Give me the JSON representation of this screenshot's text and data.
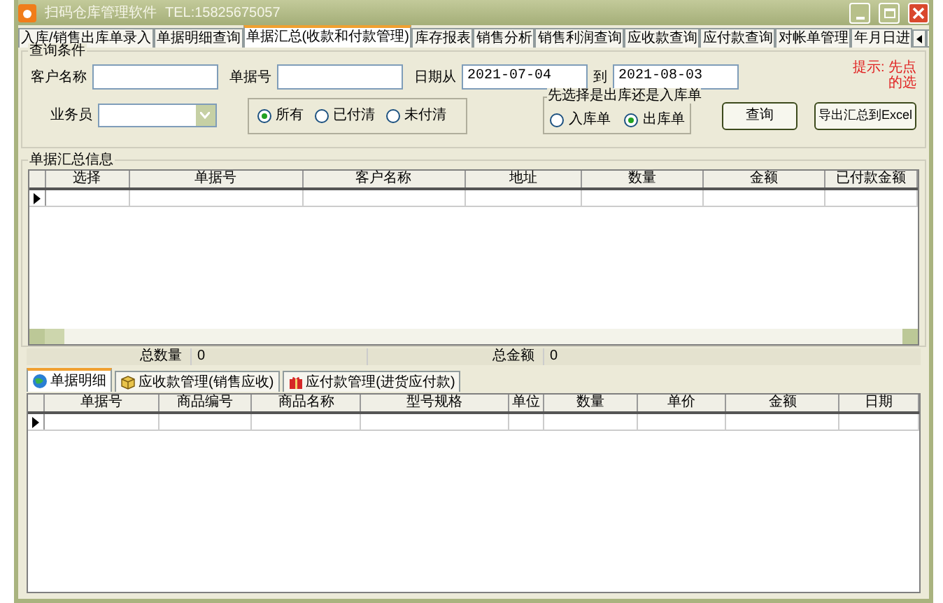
{
  "window": {
    "title": "扫码仓库管理软件",
    "phone": "TEL:15825675057"
  },
  "tabs": [
    {
      "label": "入库/销售出库单录入",
      "selected": false
    },
    {
      "label": "单据明细查询",
      "selected": false
    },
    {
      "label": "单据汇总(收款和付款管理)",
      "selected": true
    },
    {
      "label": "库存报表",
      "selected": false
    },
    {
      "label": "销售分析",
      "selected": false
    },
    {
      "label": "销售利润查询",
      "selected": false
    },
    {
      "label": "应收款查询",
      "selected": false
    },
    {
      "label": "应付款查询",
      "selected": false
    },
    {
      "label": "对帐单管理",
      "selected": false
    },
    {
      "label": "年月日进",
      "selected": false
    }
  ],
  "query": {
    "legend": "查询条件",
    "customer_label": "客户名称",
    "doc_no_label": "单据号",
    "date_from": {
      "label": "日期从",
      "value": "2021-07-04"
    },
    "date_to": {
      "label": "到",
      "value": "2021-08-03"
    },
    "salesperson_label": "业务员",
    "payment_filter": [
      {
        "label": "所有",
        "selected": true
      },
      {
        "label": "已付清",
        "selected": false
      },
      {
        "label": "未付清",
        "selected": false
      }
    ],
    "direction": {
      "legend": "先选择是出库还是入库单",
      "options": [
        {
          "label": "入库单",
          "selected": false
        },
        {
          "label": "出库单",
          "selected": true
        }
      ]
    },
    "buttons": [
      "查询",
      "导出汇总到Excel"
    ],
    "hint": [
      "提示: 先点",
      "的选"
    ]
  },
  "summary": {
    "legend": "单据汇总信息",
    "columns": [
      "选择",
      "单据号",
      "客户名称",
      "地址",
      "数量",
      "金额",
      "已付款金额"
    ],
    "total_qty": {
      "label": "总数量",
      "value": "0"
    },
    "total_amount": {
      "label": "总金额",
      "value": "0"
    }
  },
  "detail_tabs": [
    {
      "label": "单据明细",
      "selected": true,
      "kind": "globe"
    },
    {
      "label": "应收款管理(销售应收)",
      "selected": false,
      "kind": "box"
    },
    {
      "label": "应付款管理(进货应付款)",
      "selected": false,
      "kind": "gift"
    }
  ],
  "detail": {
    "columns": [
      "单据号",
      "商品编号",
      "商品名称",
      "型号规格",
      "单位",
      "数量",
      "单价",
      "金额",
      "日期"
    ]
  }
}
